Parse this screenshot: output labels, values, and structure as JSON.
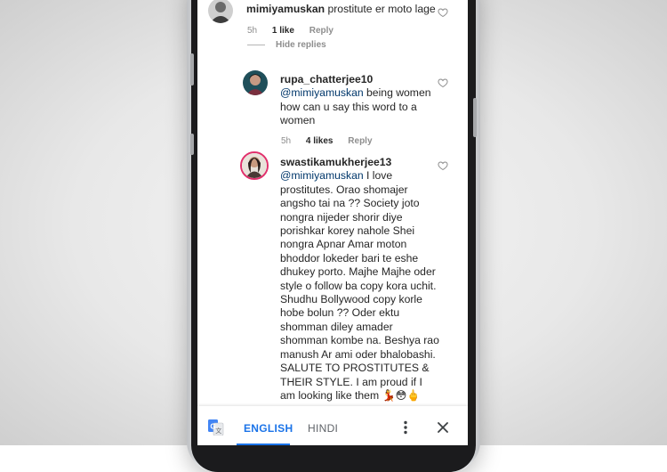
{
  "comments": [
    {
      "username": "mimiyamuskan",
      "text": "prostitute er moto lage",
      "time": "5h",
      "likes": "1 like",
      "reply_label": "Reply"
    },
    {
      "username": "rupa_chatterjee10",
      "mention": "@mimiyamuskan",
      "text": " being women how can u say this word to a women",
      "time": "5h",
      "likes": "4 likes",
      "reply_label": "Reply"
    },
    {
      "username": "swastikamukherjee13",
      "mention": "@mimiyamuskan",
      "text": " I love prostitutes. Orao shomajer angsho tai na ?? Society joto nongra nijeder shorir diye porishkar korey nahole Shei nongra Apnar Amar moton bhoddor lokeder bari te eshe dhukey porto. Majhe Majhe oder style o follow ba copy kora uchit. Shudhu Bollywood copy korle hobe bolun ?? Oder ektu shomman diley amader shomman kombe na. Beshya rao manush Ar ami oder bhalobashi. SALUTE TO PROSTITUTES & THEIR STYLE. I am proud if I am looking like them ",
      "emojis": "💃😳🖕"
    }
  ],
  "hide_replies_label": "Hide replies",
  "translate_bar": {
    "active_language": "ENGLISH",
    "other_language": "HINDI"
  },
  "icons": {
    "translate": "google-translate-icon",
    "like": "heart-outline-icon",
    "more": "more-vertical-icon",
    "close": "close-icon"
  },
  "colors": {
    "accent": "#1a73e8",
    "mention": "#00376b",
    "meta": "#8e8e8e"
  }
}
